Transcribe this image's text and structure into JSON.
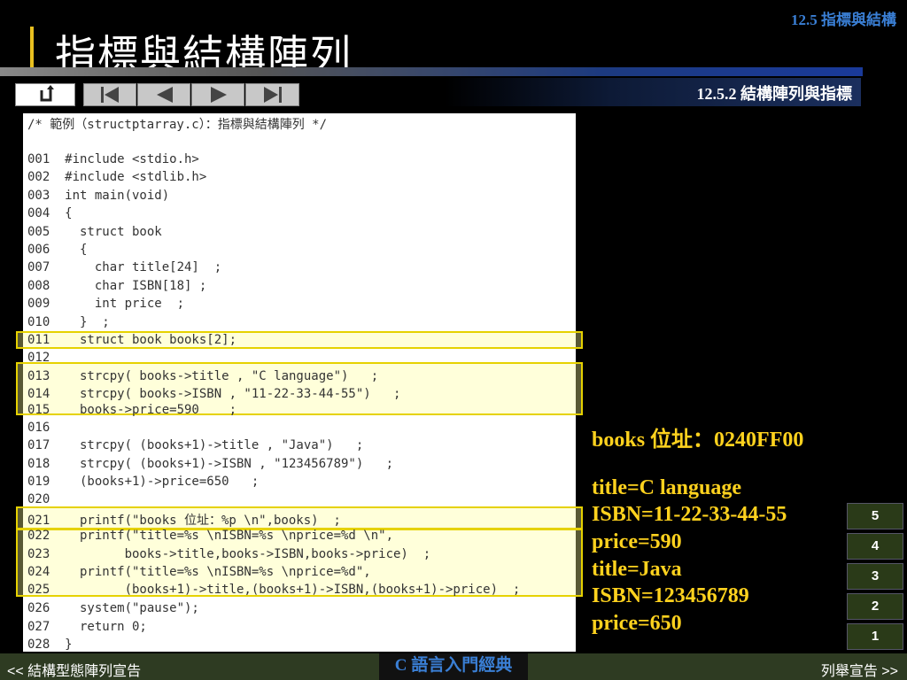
{
  "header": {
    "section": "12.5 指標與結構",
    "title": "指標與結構陣列",
    "subsection": "12.5.2 結構陣列與指標"
  },
  "nav": {
    "return_icon": "return-icon",
    "first_icon": "first-page-icon",
    "prev_icon": "previous-icon",
    "next_icon": "next-icon",
    "last_icon": "last-page-icon"
  },
  "code": [
    "/* 範例（structptarray.c）：指標與結構陣列 */",
    "",
    "001  #include <stdio.h>",
    "002  #include <stdlib.h>",
    "003  int main(void)",
    "004  {",
    "005    struct book",
    "006    {",
    "007      char title[24]  ;",
    "008      char ISBN[18] ;",
    "009      int price  ;",
    "010    }  ;",
    "011    struct book books[2];",
    "012",
    "013    strcpy( books->title , \"C language\")   ;",
    "014    strcpy( books->ISBN , \"11-22-33-44-55\")   ;",
    "015    books->price=590    ;",
    "016",
    "017    strcpy( (books+1)->title , \"Java\")   ;",
    "018    strcpy( (books+1)->ISBN , \"123456789\")   ;",
    "019    (books+1)->price=650   ;",
    "020",
    "021    printf(\"books 位址：%p \\n\",books)  ;",
    "022    printf(\"title=%s \\nISBN=%s \\nprice=%d \\n\",",
    "023          books->title,books->ISBN,books->price)  ;",
    "024    printf(\"title=%s \\nISBN=%s \\nprice=%d\",",
    "025          (books+1)->title,(books+1)->ISBN,(books+1)->price)  ;",
    "026    system(\"pause\");",
    "027    return 0;",
    "028  }"
  ],
  "output": [
    "books 位址：0240FF00",
    "",
    "title=C language",
    "ISBN=11-22-33-44-55",
    "price=590",
    "title=Java",
    "ISBN=123456789",
    "price=650"
  ],
  "pages": [
    "5",
    "4",
    "3",
    "2",
    "1"
  ],
  "footer": {
    "prev": "<< 結構型態陣列宣告",
    "center": "C 語言入門經典",
    "next": "列舉宣告 >>"
  },
  "colors": {
    "output_text": "#ffd21e",
    "highlight_border": "#e6d200",
    "accent_blue": "#3a7fd5"
  }
}
